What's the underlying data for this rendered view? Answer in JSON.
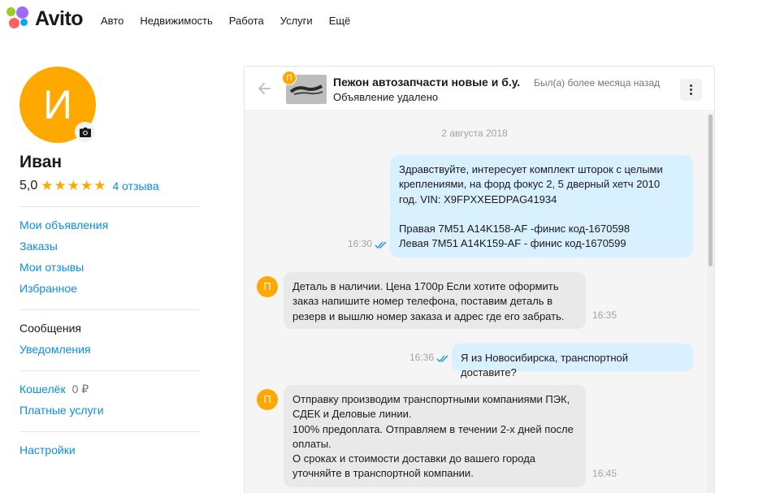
{
  "brand": {
    "logo_text": "Avito"
  },
  "nav": {
    "items": [
      "Авто",
      "Недвижимость",
      "Работа",
      "Услуги",
      "Ещё"
    ]
  },
  "profile": {
    "avatar_letter": "И",
    "name": "Иван",
    "rating": "5,0",
    "stars": 5,
    "reviews_label": "4 отзыва"
  },
  "sidebar": {
    "group1": [
      "Мои объявления",
      "Заказы",
      "Мои отзывы",
      "Избранное"
    ],
    "group2": {
      "messages": "Сообщения",
      "notifications": "Уведомления"
    },
    "group3": {
      "wallet_label": "Кошелёк",
      "wallet_amount": "0 ₽",
      "paid_services": "Платные услуги"
    },
    "group4": {
      "settings": "Настройки"
    }
  },
  "chat": {
    "header": {
      "badge_letter": "П",
      "title": "Пежон автозапчасти новые и б.у.",
      "last_seen": "Был(а) более месяца назад",
      "subtitle": "Объявление удалено"
    },
    "date_separator": "2 августа 2018",
    "messages": [
      {
        "direction": "out",
        "time": "16:30",
        "read": true,
        "text": "Здравствуйте, интересует комплект шторок с целыми\nкреплениями, на форд фокус 2, 5 дверный хетч 2010\nгод. VIN: X9FPXXEEDPAG41934\n\nПравая 7M51 A14K158-AF -финис код-1670598\nЛевая 7M51 A14K159-AF - финис код-1670599"
      },
      {
        "direction": "in",
        "avatar_letter": "П",
        "time": "16:35",
        "text": "Деталь в наличии. Цена 1700р Если хотите оформить\nзаказ напишите номер телефона, поставим деталь в\nрезерв и вышлю номер заказа и адрес где его забрать."
      },
      {
        "direction": "out",
        "time": "16:36",
        "read": true,
        "text": "Я из Новосибирска, транспортной доставите?"
      },
      {
        "direction": "in",
        "avatar_letter": "П",
        "time": "16:45",
        "text": "Отправку производим транспортными компаниями ПЭК,\nСДЕК и Деловые линии.\n100% предоплата. Отправляем в течении 2-х дней после\nоплаты.\nО сроках и стоимости доставки до вашего города\nуточняйте в транспортной компании."
      }
    ]
  },
  "colors": {
    "accent_orange": "#ffa800",
    "link_blue": "#0a8de8",
    "outgoing_bubble": "#d8f0ff",
    "incoming_bubble": "#e9e9e9",
    "read_tick": "#0a8de8"
  },
  "icons": {
    "back": "arrow-left-icon",
    "camera": "camera-icon",
    "menu": "more-vertical-icon",
    "read": "double-check-icon",
    "star": "star-icon"
  }
}
